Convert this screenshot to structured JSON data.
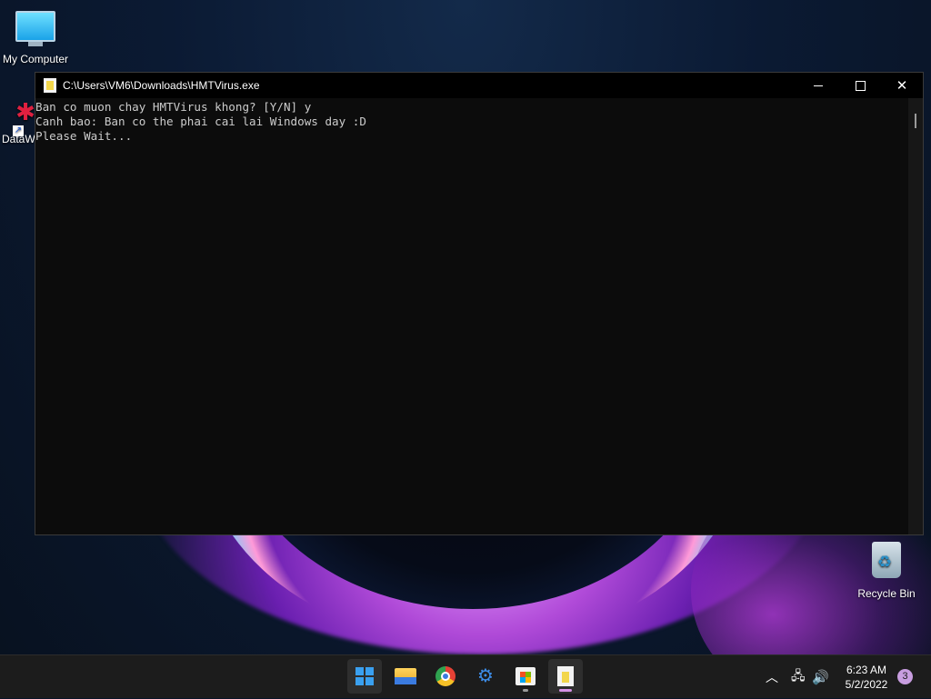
{
  "desktop": {
    "icons": {
      "my_computer": "My Computer",
      "dataw": "DataW",
      "recycle_bin": "Recycle Bin"
    }
  },
  "console": {
    "title": "C:\\Users\\VM6\\Downloads\\HMTVirus.exe",
    "lines": [
      "Ban co muon chay HMTVirus khong? [Y/N] y",
      "Canh bao: Ban co the phai cai lai Windows day :D",
      "Please Wait..."
    ]
  },
  "taskbar": {
    "apps": [
      "start-icon",
      "file-explorer-icon",
      "chrome-icon",
      "devtools-icon",
      "store-icon",
      "console-app-icon"
    ],
    "clock_time": "6:23 AM",
    "clock_date": "5/2/2022",
    "notification_count": "3"
  },
  "colors": {
    "console_bg": "#0c0c0c",
    "console_text": "#cccccc",
    "taskbar_bg": "#1c1c1c",
    "active_indicator": "#d691e6"
  }
}
